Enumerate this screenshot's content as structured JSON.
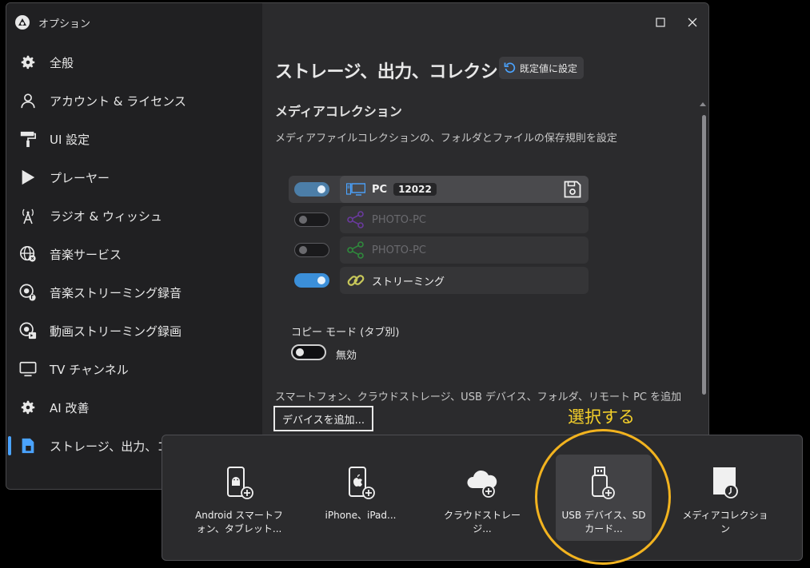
{
  "window": {
    "title": "オプション"
  },
  "sidebar": {
    "items": [
      {
        "label": "全般",
        "icon": "gear-icon"
      },
      {
        "label": "アカウント & ライセンス",
        "icon": "person-icon"
      },
      {
        "label": "UI 設定",
        "icon": "paint-roller-icon"
      },
      {
        "label": "プレーヤー",
        "icon": "play-icon"
      },
      {
        "label": "ラジオ & ウィッシュ",
        "icon": "antenna-icon"
      },
      {
        "label": "音楽サービス",
        "icon": "globe-icon"
      },
      {
        "label": "音楽ストリーミング録音",
        "icon": "music-record-icon"
      },
      {
        "label": "動画ストリーミング録画",
        "icon": "video-record-icon"
      },
      {
        "label": "TV チャンネル",
        "icon": "tv-icon"
      },
      {
        "label": "AI 改善",
        "icon": "gear-icon"
      },
      {
        "label": "ストレージ、出力、コレクション",
        "icon": "storage-icon",
        "active": true
      }
    ]
  },
  "main": {
    "title": "ストレージ、出力、コレクション",
    "reset_label": "既定値に設定",
    "section_title": "メディアコレクション",
    "section_desc": "メディアファイルコレクションの、フォルダとファイルの保存規則を設定",
    "devices": [
      {
        "label": "PC",
        "badge": "12022",
        "state": "on",
        "icon": "pc-icon",
        "selected": true
      },
      {
        "label": "PHOTO-PC",
        "state": "off",
        "icon": "share-icon"
      },
      {
        "label": "PHOTO-PC",
        "state": "off",
        "icon": "share-icon"
      },
      {
        "label": "ストリーミング",
        "state": "on",
        "icon": "link-icon"
      }
    ],
    "copy_mode_label": "コピー モード (タブ別)",
    "copy_mode_state": "無効",
    "add_desc": "スマートフォン、クラウドストレージ、USB デバイス、フォルダ、リモート PC を追加",
    "add_button": "デバイスを追加..."
  },
  "popup": {
    "tiles": [
      {
        "label": "Android スマートフォン、タブレット...",
        "icon": "android-phone-icon"
      },
      {
        "label": "iPhone、iPad...",
        "icon": "iphone-icon"
      },
      {
        "label": "クラウドストレージ...",
        "icon": "cloud-icon"
      },
      {
        "label": "USB デバイス、SD カード...",
        "icon": "usb-icon",
        "highlighted": true
      },
      {
        "label": "メディアコレクション",
        "icon": "media-collection-icon"
      }
    ]
  },
  "annotation": {
    "text": "選択する",
    "color": "#f2b31f"
  },
  "colors": {
    "accent": "#3b8fd9",
    "sidebar_bg": "#202022",
    "main_bg": "#2b2b2d"
  }
}
